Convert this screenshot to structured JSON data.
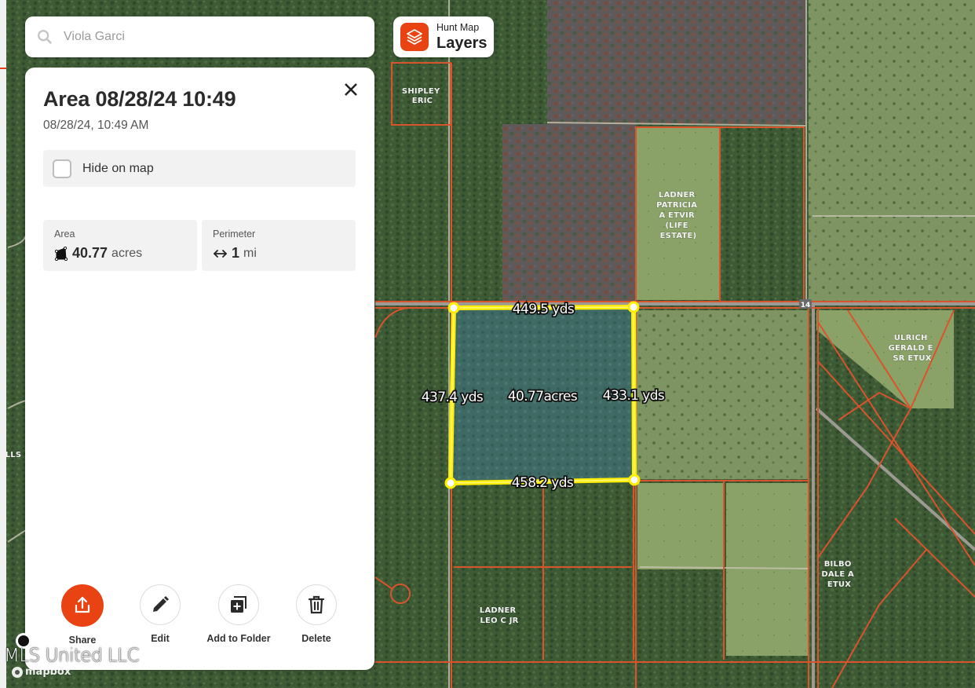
{
  "search": {
    "value": "Viola Garci",
    "icon": "search-icon"
  },
  "layers_button": {
    "sub_label": "Hunt Map",
    "main_label": "Layers",
    "icon": "layers-icon",
    "color": "#ea4313"
  },
  "panel": {
    "title": "Area 08/28/24 10:49",
    "subtitle": "08/28/24, 10:49 AM",
    "hide_on_map": {
      "label": "Hide on map",
      "checked": false
    },
    "stats": [
      {
        "label": "Area",
        "value": "40.77",
        "unit": "acres",
        "icon": "area-polygon-icon"
      },
      {
        "label": "Perimeter",
        "value": "1",
        "unit": "mi",
        "icon": "left-right-arrow-icon"
      }
    ],
    "actions": [
      {
        "label": "Share",
        "icon": "share-upload-icon",
        "primary": true
      },
      {
        "label": "Edit",
        "icon": "pencil-icon",
        "primary": false
      },
      {
        "label": "Add to Folder",
        "icon": "add-to-folder-icon",
        "primary": false
      },
      {
        "label": "Delete",
        "icon": "trash-icon",
        "primary": false
      }
    ]
  },
  "map": {
    "measured_area": {
      "area_label": "40.77acres",
      "edges": {
        "top": "449.5 yds",
        "right": "433.1 yds",
        "bottom": "458.2 yds",
        "left": "437.4 yds"
      },
      "stroke_color": "#ffee00"
    },
    "parcel_line_color": "#d9532b",
    "parcel_labels": [
      {
        "id": "shipley",
        "lines": [
          "SHIPLEY",
          "ERIC"
        ]
      },
      {
        "id": "ladner-patricia",
        "lines": [
          "LADNER",
          "PATRICIA",
          "A ETVIR",
          "(LIFE",
          "ESTATE)"
        ]
      },
      {
        "id": "ulrich",
        "lines": [
          "ULRICH",
          "GERALD E",
          "SR ETUX"
        ]
      },
      {
        "id": "bilbo",
        "lines": [
          "BILBO",
          "DALE A",
          "ETUX"
        ]
      },
      {
        "id": "ladner-leo",
        "lines": [
          "LADNER",
          "LEO C JR"
        ]
      },
      {
        "id": "edge-fragment",
        "lines": [
          "LLS"
        ]
      }
    ],
    "road_label": "14",
    "attribution": "mapbox",
    "watermark": "MLS United LLC"
  }
}
